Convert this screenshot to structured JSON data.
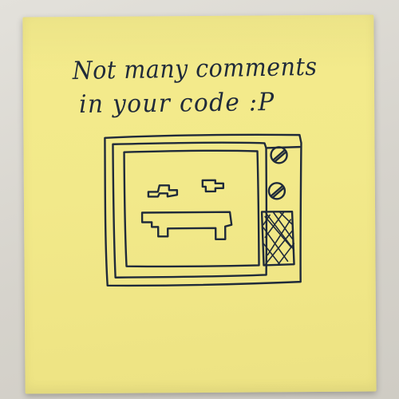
{
  "note": {
    "line1": "Not many comments",
    "line2": "in your code :P"
  },
  "colors": {
    "paper": "#f2e98a",
    "ink": "#1f2a3a",
    "background": "#d9d6cf"
  },
  "icons": [
    "tv-drawing",
    "dial-icon",
    "speaker-grille-icon",
    "face-eye-icon",
    "face-mouth-icon"
  ]
}
